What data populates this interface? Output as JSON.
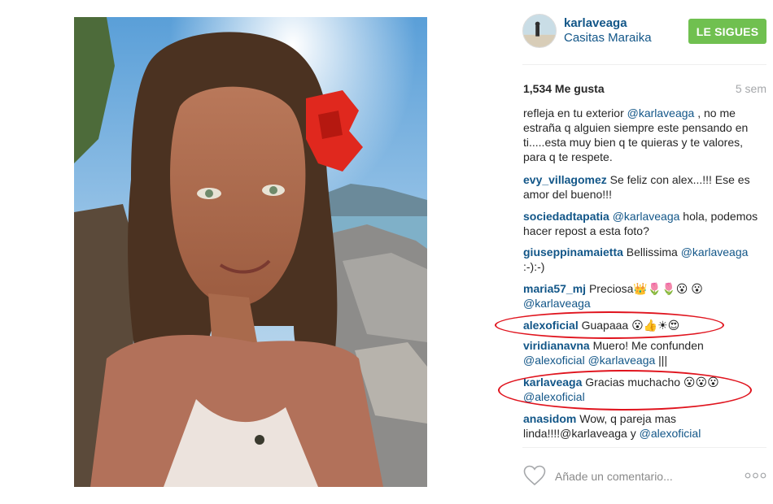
{
  "post": {
    "username": "karlaveaga",
    "location": "Casitas Maraika",
    "follow_label": "LE SIGUES",
    "likes": "1,534 Me gusta",
    "time": "5 sem",
    "add_comment_placeholder": "Añade un comentario...",
    "icons": [
      "heart-icon",
      "more-options-icon"
    ]
  },
  "comments": [
    {
      "author": "",
      "parts": [
        "refleja en tu exterior ",
        "@karlaveaga",
        " , no me estraña q alguien siempre este pensando en ti.....esta muy bien q te quieras y te valores, para q te respete."
      ]
    },
    {
      "author": "evy_villagomez",
      "parts": [
        " Se feliz con alex...!!! Ese es amor del bueno!!!"
      ]
    },
    {
      "author": "sociedadtapatia",
      "parts": [
        " ",
        "@karlaveaga",
        " hola, podemos hacer repost a esta foto?"
      ]
    },
    {
      "author": "giuseppinamaietta",
      "parts": [
        " Bellissima ",
        "@karlaveaga",
        " :-):-)"
      ]
    },
    {
      "author": "maria57_mj",
      "parts": [
        " Preciosa👑🌷🌷😮 😮",
        "@karlaveaga"
      ]
    },
    {
      "author": "alexoficial",
      "parts": [
        " Guapaaa 😮👍☀😍"
      ]
    },
    {
      "author": "viridianavna",
      "parts": [
        " Muero! Me confunden ",
        "@alexoficial",
        " ",
        "@karlaveaga",
        " |||"
      ]
    },
    {
      "author": "karlaveaga",
      "parts": [
        " Gracias muchacho 😮😮😮 ",
        "@alexoficial"
      ]
    },
    {
      "author": "anasidom",
      "parts": [
        " Wow, q pareja mas linda!!!!@karlaveaga y ",
        "@alexoficial"
      ]
    }
  ],
  "colors": {
    "link": "#125688",
    "follow_button": "#70c050",
    "highlight_annotation": "#e0141e",
    "muted": "#a5a7aa"
  }
}
